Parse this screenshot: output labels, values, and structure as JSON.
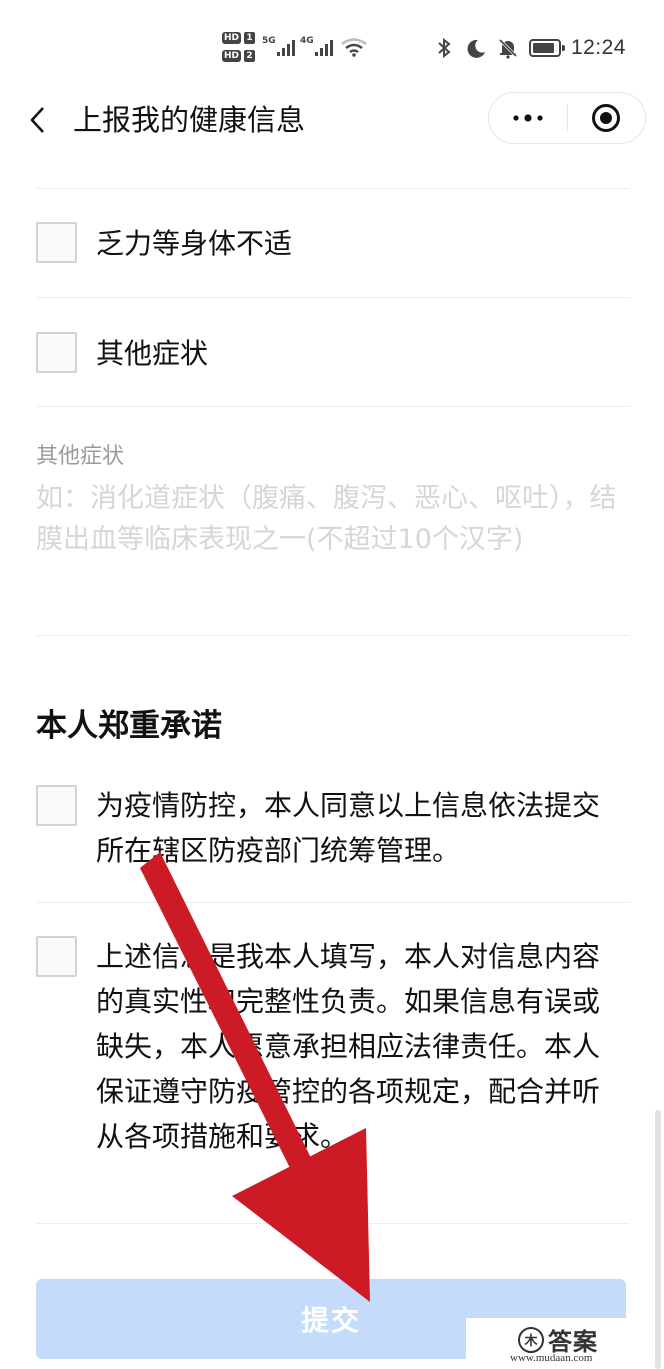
{
  "status_bar": {
    "hd1": "HD",
    "sim1": "1",
    "hd2": "HD",
    "sim2": "2",
    "signal1_tag": "5G",
    "signal2_tag": "4G",
    "icons": [
      "bluetooth-icon",
      "moon-icon",
      "bell-off-icon",
      "battery-icon"
    ],
    "time": "12:24"
  },
  "nav": {
    "back_icon": "chevron-left-icon",
    "title": "上报我的健康信息",
    "capsule_more_icon": "more-dots-icon",
    "capsule_close_icon": "target-circle-icon"
  },
  "symptoms": {
    "items": [
      {
        "label": "乏力等身体不适",
        "checked": false
      },
      {
        "label": "其他症状",
        "checked": false
      }
    ],
    "other": {
      "label": "其他症状",
      "placeholder": "如：消化道症状（腹痛、腹泻、恶心、呕吐），结膜出血等临床表现之一(不超过10个汉字)",
      "value": ""
    }
  },
  "pledge": {
    "title": "本人郑重承诺",
    "items": [
      {
        "text": "为疫情防控，本人同意以上信息依法提交所在辖区防疫部门统筹管理。",
        "checked": false
      },
      {
        "text": "上述信息是我本人填写，本人对信息内容的真实性和完整性负责。如果信息有误或缺失，本人愿意承担相应法律责任。本人保证遵守防疫管控的各项规定，配合并听从各项措施和要求。",
        "checked": false
      }
    ]
  },
  "submit": {
    "label": "提交",
    "color": "#c5dbfa"
  },
  "annotation": {
    "type": "arrow",
    "color": "#cc1b25",
    "points_to": "submit-button"
  },
  "watermark": {
    "logo_glyph": "木",
    "text": "答案",
    "url": "www.mudaan.com"
  }
}
